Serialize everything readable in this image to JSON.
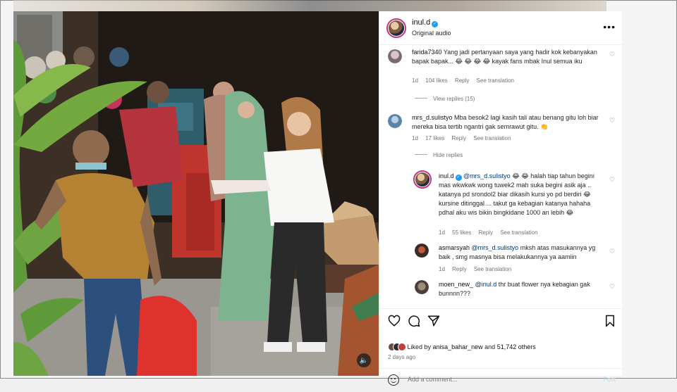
{
  "post": {
    "username": "inul.d",
    "audio_label": "Original audio",
    "more_icon": "more-options-icon"
  },
  "comments": [
    {
      "user": "farida7340",
      "text": "Yang jadi pertanyaan saya yang hadir kok kebanyakan bapak bapak... 😂 😂 😂 😂 kayak fans mbak Inul semua iku",
      "time": "1d",
      "likes": "104 likes",
      "reply": "Reply",
      "translate": "See translation",
      "replies_toggle": "View replies (15)"
    },
    {
      "user": "mrs_d.sulistyo",
      "text": "Mba besok2 lagi kasih tali atau benang gitu loh biar mereka bisa tertib ngantri gak semrawut gitu. 👏",
      "time": "1d",
      "likes": "17 likes",
      "reply": "Reply",
      "translate": "See translation",
      "replies_toggle": "Hide replies"
    }
  ],
  "replies": [
    {
      "user": "inul.d",
      "mention": "@mrs_d.sulistyo",
      "text": "😂 😂 halah tiap tahun begini mas wkwkwk wong tuwek2 mah suka begini asik aja .. katanya pd srondol2 biar dikasih kursi yo pd berdiri 😂 kursine ditinggal ... takut ga kebagian katanya hahaha pdhal aku wis bikin bingkidane 1000 an lebih 😂",
      "time": "1d",
      "likes": "55 likes",
      "reply": "Reply",
      "translate": "See translation"
    },
    {
      "user": "asmarsyah",
      "mention": "@mrs_d.sulistyo",
      "text": "mksh atas masukannya yg baik , smg masnya bisa melakukannya ya aamiin",
      "time": "1d",
      "reply": "Reply",
      "translate": "See translation"
    },
    {
      "user": "moen_new_",
      "mention": "@inul.d",
      "text": "thr buat flower nya kebagian gak bunnnn???"
    }
  ],
  "actions": {
    "liked_prefix": "Liked by",
    "liked_user": "anisa_bahar_new",
    "liked_and": "and",
    "liked_count": "51,742 others",
    "time_ago": "2 days ago",
    "add_comment_placeholder": "Add a comment...",
    "post_label": "Post"
  },
  "colors": {
    "accent_link": "#00376b",
    "verified": "#1d9bf0",
    "post_button_disabled": "#b2dffc"
  }
}
